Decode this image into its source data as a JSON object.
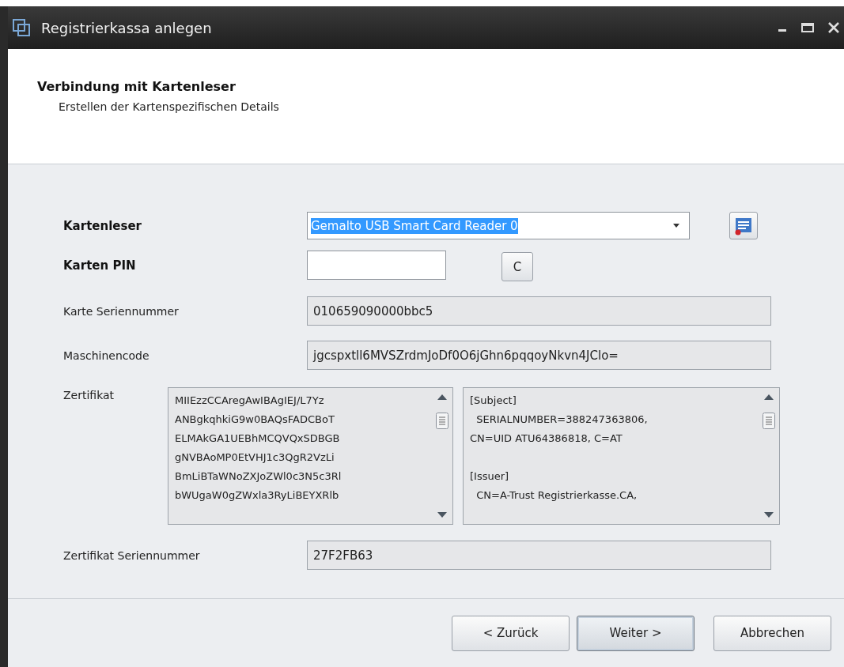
{
  "window": {
    "title": "Registrierkassa anlegen"
  },
  "header": {
    "title": "Verbindung mit Kartenleser",
    "subtitle": "Erstellen der Kartenspezifischen Details"
  },
  "fields": [
    {
      "kind": "combo",
      "label": "Kartenleser",
      "bold": true,
      "value": "Gemalto USB Smart Card Reader 0",
      "text_selected": true
    },
    {
      "kind": "input",
      "label": "Karten PIN",
      "bold": true,
      "button": "C"
    },
    {
      "kind": "readonly",
      "label": "Karte Seriennummer",
      "bold": false,
      "value": "010659090000bbc5"
    },
    {
      "kind": "readonly",
      "label": "Maschinencode",
      "bold": false,
      "value": "jgcspxtll6MVSZrdmJoDf0O6jGhn6pqqoyNkvn4JClo="
    },
    {
      "kind": "textareas",
      "label": "Zertifikat",
      "bold": false,
      "boxes": [
        {
          "lines": [
            "MIIEzzCCAregAwIBAgIEJ/L7Yz",
            "ANBgkqhkiG9w0BAQsFADCBoT",
            "ELMAkGA1UEBhMCQVQxSDBGB",
            "gNVBAoMP0EtVHJ1c3QgR2VzLi",
            "BmLiBTaWNoZXJoZWl0c3N5c3Rl",
            "bWUgaW0gZWxla3RyLiBEYXRlb"
          ]
        },
        {
          "paragraphs": [
            [
              "[Subject]",
              "  SERIALNUMBER=388247363806,",
              "CN=UID ATU64386818, C=AT"
            ],
            [
              "[Issuer]",
              "  CN=A-Trust Registrierkasse.CA,"
            ]
          ]
        }
      ]
    },
    {
      "kind": "readonly",
      "label": "Zertifikat Seriennummer",
      "bold": false,
      "value": "27F2FB63"
    }
  ],
  "buttons": [
    {
      "label": "< Zurück",
      "focused": false
    },
    {
      "label": "Weiter >",
      "focused": true
    },
    {
      "label": "Abbrechen",
      "focused": false
    }
  ]
}
